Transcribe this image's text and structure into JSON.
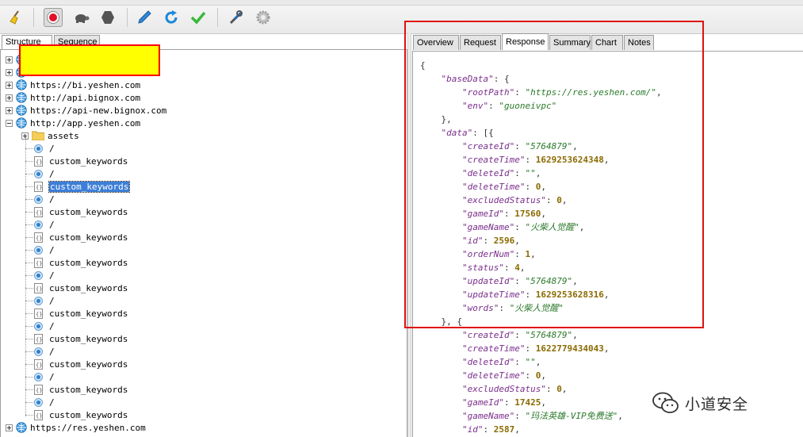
{
  "left_tabs": [
    "Structure",
    "Sequence"
  ],
  "right_tabs": [
    "Overview",
    "Request",
    "Response",
    "Summary",
    "Chart",
    "Notes"
  ],
  "active_right_tab": "Response",
  "tree": {
    "hosts_top": [
      "https://bi.yeshen.com",
      "http://api.bignox.com",
      "https://api-new.bignox.com",
      "http://app.yeshen.com"
    ],
    "folder": "assets",
    "children": [
      "/",
      "custom_keywords",
      "/",
      "custom_keywords",
      "/",
      "custom_keywords",
      "/",
      "custom_keywords",
      "/",
      "custom_keywords",
      "/",
      "custom_keywords",
      "/",
      "custom_keywords",
      "/",
      "custom_keywords",
      "/",
      "custom_keywords",
      "/",
      "custom_keywords",
      "/",
      "custom_keywords"
    ],
    "selected_index": 3,
    "host_bottom": "https://res.yeshen.com"
  },
  "json_lines": [
    [
      {
        "t": "p",
        "v": "{"
      }
    ],
    [
      {
        "t": "p",
        "v": "    "
      },
      {
        "t": "k",
        "v": "\"baseData\""
      },
      {
        "t": "p",
        "v": ": {"
      }
    ],
    [
      {
        "t": "p",
        "v": "        "
      },
      {
        "t": "k",
        "v": "\"rootPath\""
      },
      {
        "t": "p",
        "v": ": "
      },
      {
        "t": "s",
        "v": "\"https://res.yeshen.com/\""
      },
      {
        "t": "p",
        "v": ","
      }
    ],
    [
      {
        "t": "p",
        "v": "        "
      },
      {
        "t": "k",
        "v": "\"env\""
      },
      {
        "t": "p",
        "v": ": "
      },
      {
        "t": "s",
        "v": "\"guoneivpc\""
      }
    ],
    [
      {
        "t": "p",
        "v": "    },"
      }
    ],
    [
      {
        "t": "p",
        "v": "    "
      },
      {
        "t": "k",
        "v": "\"data\""
      },
      {
        "t": "p",
        "v": ": [{"
      }
    ],
    [
      {
        "t": "p",
        "v": "        "
      },
      {
        "t": "k",
        "v": "\"createId\""
      },
      {
        "t": "p",
        "v": ": "
      },
      {
        "t": "s",
        "v": "\"5764879\""
      },
      {
        "t": "p",
        "v": ","
      }
    ],
    [
      {
        "t": "p",
        "v": "        "
      },
      {
        "t": "k",
        "v": "\"createTime\""
      },
      {
        "t": "p",
        "v": ": "
      },
      {
        "t": "n",
        "v": "1629253624348"
      },
      {
        "t": "p",
        "v": ","
      }
    ],
    [
      {
        "t": "p",
        "v": "        "
      },
      {
        "t": "k",
        "v": "\"deleteId\""
      },
      {
        "t": "p",
        "v": ": "
      },
      {
        "t": "s",
        "v": "\"\""
      },
      {
        "t": "p",
        "v": ","
      }
    ],
    [
      {
        "t": "p",
        "v": "        "
      },
      {
        "t": "k",
        "v": "\"deleteTime\""
      },
      {
        "t": "p",
        "v": ": "
      },
      {
        "t": "n",
        "v": "0"
      },
      {
        "t": "p",
        "v": ","
      }
    ],
    [
      {
        "t": "p",
        "v": "        "
      },
      {
        "t": "k",
        "v": "\"excludedStatus\""
      },
      {
        "t": "p",
        "v": ": "
      },
      {
        "t": "n",
        "v": "0"
      },
      {
        "t": "p",
        "v": ","
      }
    ],
    [
      {
        "t": "p",
        "v": "        "
      },
      {
        "t": "k",
        "v": "\"gameId\""
      },
      {
        "t": "p",
        "v": ": "
      },
      {
        "t": "n",
        "v": "17560"
      },
      {
        "t": "p",
        "v": ","
      }
    ],
    [
      {
        "t": "p",
        "v": "        "
      },
      {
        "t": "k",
        "v": "\"gameName\""
      },
      {
        "t": "p",
        "v": ": "
      },
      {
        "t": "s",
        "v": "\"火柴人觉醒\""
      },
      {
        "t": "p",
        "v": ","
      }
    ],
    [
      {
        "t": "p",
        "v": "        "
      },
      {
        "t": "k",
        "v": "\"id\""
      },
      {
        "t": "p",
        "v": ": "
      },
      {
        "t": "n",
        "v": "2596"
      },
      {
        "t": "p",
        "v": ","
      }
    ],
    [
      {
        "t": "p",
        "v": "        "
      },
      {
        "t": "k",
        "v": "\"orderNum\""
      },
      {
        "t": "p",
        "v": ": "
      },
      {
        "t": "n",
        "v": "1"
      },
      {
        "t": "p",
        "v": ","
      }
    ],
    [
      {
        "t": "p",
        "v": "        "
      },
      {
        "t": "k",
        "v": "\"status\""
      },
      {
        "t": "p",
        "v": ": "
      },
      {
        "t": "n",
        "v": "4"
      },
      {
        "t": "p",
        "v": ","
      }
    ],
    [
      {
        "t": "p",
        "v": "        "
      },
      {
        "t": "k",
        "v": "\"updateId\""
      },
      {
        "t": "p",
        "v": ": "
      },
      {
        "t": "s",
        "v": "\"5764879\""
      },
      {
        "t": "p",
        "v": ","
      }
    ],
    [
      {
        "t": "p",
        "v": "        "
      },
      {
        "t": "k",
        "v": "\"updateTime\""
      },
      {
        "t": "p",
        "v": ": "
      },
      {
        "t": "n",
        "v": "1629253628316"
      },
      {
        "t": "p",
        "v": ","
      }
    ],
    [
      {
        "t": "p",
        "v": "        "
      },
      {
        "t": "k",
        "v": "\"words\""
      },
      {
        "t": "p",
        "v": ": "
      },
      {
        "t": "s",
        "v": "\"火柴人觉醒\""
      }
    ],
    [
      {
        "t": "p",
        "v": "    }, {"
      }
    ],
    [
      {
        "t": "p",
        "v": "        "
      },
      {
        "t": "k",
        "v": "\"createId\""
      },
      {
        "t": "p",
        "v": ": "
      },
      {
        "t": "s",
        "v": "\"5764879\""
      },
      {
        "t": "p",
        "v": ","
      }
    ],
    [
      {
        "t": "p",
        "v": "        "
      },
      {
        "t": "k",
        "v": "\"createTime\""
      },
      {
        "t": "p",
        "v": ": "
      },
      {
        "t": "n",
        "v": "1622779434043"
      },
      {
        "t": "p",
        "v": ","
      }
    ],
    [
      {
        "t": "p",
        "v": "        "
      },
      {
        "t": "k",
        "v": "\"deleteId\""
      },
      {
        "t": "p",
        "v": ": "
      },
      {
        "t": "s",
        "v": "\"\""
      },
      {
        "t": "p",
        "v": ","
      }
    ],
    [
      {
        "t": "p",
        "v": "        "
      },
      {
        "t": "k",
        "v": "\"deleteTime\""
      },
      {
        "t": "p",
        "v": ": "
      },
      {
        "t": "n",
        "v": "0"
      },
      {
        "t": "p",
        "v": ","
      }
    ],
    [
      {
        "t": "p",
        "v": "        "
      },
      {
        "t": "k",
        "v": "\"excludedStatus\""
      },
      {
        "t": "p",
        "v": ": "
      },
      {
        "t": "n",
        "v": "0"
      },
      {
        "t": "p",
        "v": ","
      }
    ],
    [
      {
        "t": "p",
        "v": "        "
      },
      {
        "t": "k",
        "v": "\"gameId\""
      },
      {
        "t": "p",
        "v": ": "
      },
      {
        "t": "n",
        "v": "17425"
      },
      {
        "t": "p",
        "v": ","
      }
    ],
    [
      {
        "t": "p",
        "v": "        "
      },
      {
        "t": "k",
        "v": "\"gameName\""
      },
      {
        "t": "p",
        "v": ": "
      },
      {
        "t": "s",
        "v": "\"玛法英雄-VIP免费送\""
      },
      {
        "t": "p",
        "v": ","
      }
    ],
    [
      {
        "t": "p",
        "v": "        "
      },
      {
        "t": "k",
        "v": "\"id\""
      },
      {
        "t": "p",
        "v": ": "
      },
      {
        "t": "n",
        "v": "2587"
      },
      {
        "t": "p",
        "v": ","
      }
    ]
  ],
  "watermark": "小道安全",
  "colors": {
    "selection": "#3d7fd8",
    "annotation_red": "#e01010",
    "redaction": "#ffff00",
    "json_key": "#7a2e8c",
    "json_string": "#2a7a2a",
    "json_number": "#8a6a00"
  },
  "toolbar_icons": [
    "broom-icon",
    "record-icon",
    "turtle-icon",
    "stop-hexagon-icon",
    "pen-icon",
    "refresh-icon",
    "check-icon",
    "tools-icon",
    "settings-gear-icon"
  ]
}
